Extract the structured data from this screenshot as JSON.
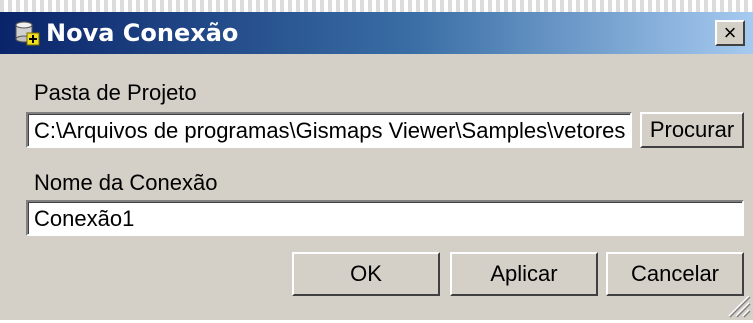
{
  "dialog": {
    "title": "Nova Conexão",
    "close_label": "×"
  },
  "project_folder": {
    "label": "Pasta de Projeto",
    "value": "C:\\Arquivos de programas\\Gismaps Viewer\\Samples\\vetores",
    "browse_label": "Procurar"
  },
  "connection_name": {
    "label": "Nome da Conexão",
    "value": "Conexão1"
  },
  "buttons": {
    "ok": "OK",
    "apply": "Aplicar",
    "cancel": "Cancelar"
  },
  "icons": {
    "title": "database-add-icon",
    "resize": "resize-grip-icon"
  },
  "colors": {
    "titlebar_start": "#0a246a",
    "titlebar_end": "#a6caf0",
    "dialog_face": "#d4d0c8"
  }
}
